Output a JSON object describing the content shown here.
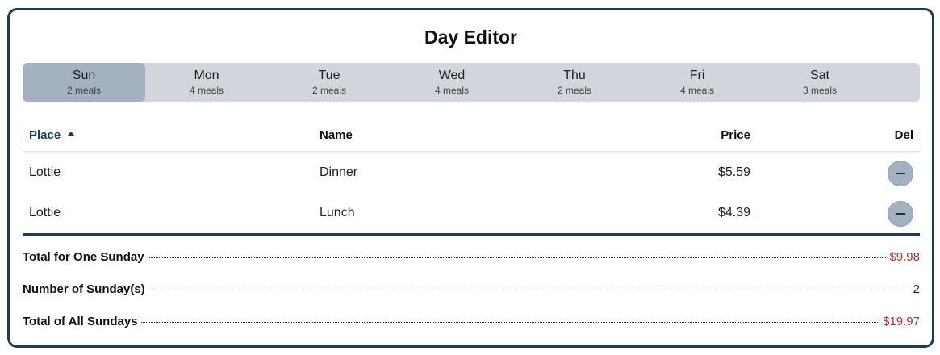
{
  "title": "Day Editor",
  "tabs": [
    {
      "day": "Sun",
      "count": "2 meals",
      "selected": true
    },
    {
      "day": "Mon",
      "count": "4 meals"
    },
    {
      "day": "Tue",
      "count": "2 meals"
    },
    {
      "day": "Wed",
      "count": "4 meals"
    },
    {
      "day": "Thu",
      "count": "2 meals"
    },
    {
      "day": "Fri",
      "count": "4 meals"
    },
    {
      "day": "Sat",
      "count": "3 meals"
    }
  ],
  "table": {
    "headers": {
      "place": "Place",
      "name": "Name",
      "price": "Price",
      "del": "Del"
    },
    "sort": {
      "column": "place",
      "direction": "ascending"
    },
    "rows": [
      {
        "place": "Lottie",
        "name": "Dinner",
        "price": "$5.59"
      },
      {
        "place": "Lottie",
        "name": "Lunch",
        "price": "$4.39"
      }
    ]
  },
  "summary": [
    {
      "label": "Total for One Sunday",
      "value": "$9.98"
    },
    {
      "label": "Number of Sunday(s)",
      "value": "2"
    },
    {
      "label": "Total of All Sundays",
      "value": "$19.97"
    }
  ],
  "colors": {
    "accent": "#1d3a5c",
    "selected_tab": "#a3b1c0",
    "money": "#a33a33"
  }
}
